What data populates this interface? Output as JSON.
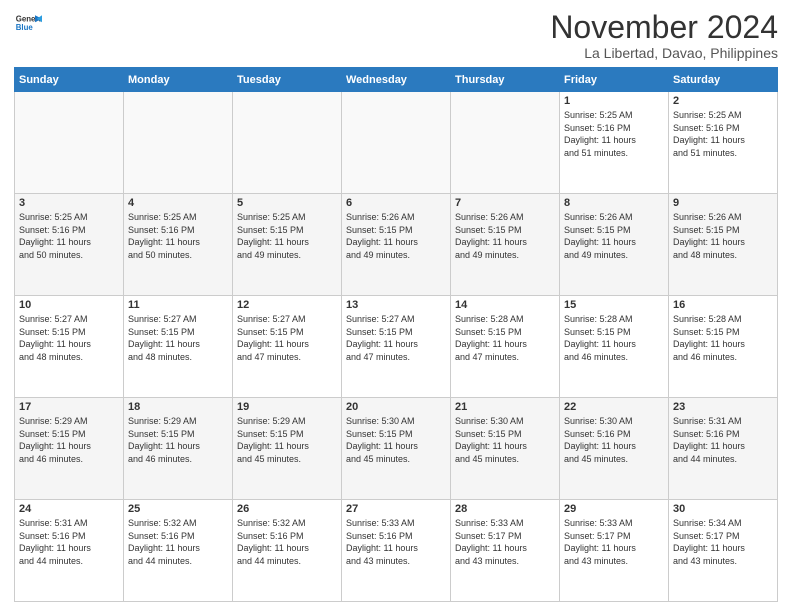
{
  "header": {
    "logo_line1": "General",
    "logo_line2": "Blue",
    "month": "November 2024",
    "location": "La Libertad, Davao, Philippines"
  },
  "weekdays": [
    "Sunday",
    "Monday",
    "Tuesday",
    "Wednesday",
    "Thursday",
    "Friday",
    "Saturday"
  ],
  "weeks": [
    [
      {
        "day": "",
        "info": ""
      },
      {
        "day": "",
        "info": ""
      },
      {
        "day": "",
        "info": ""
      },
      {
        "day": "",
        "info": ""
      },
      {
        "day": "",
        "info": ""
      },
      {
        "day": "1",
        "info": "Sunrise: 5:25 AM\nSunset: 5:16 PM\nDaylight: 11 hours\nand 51 minutes."
      },
      {
        "day": "2",
        "info": "Sunrise: 5:25 AM\nSunset: 5:16 PM\nDaylight: 11 hours\nand 51 minutes."
      }
    ],
    [
      {
        "day": "3",
        "info": "Sunrise: 5:25 AM\nSunset: 5:16 PM\nDaylight: 11 hours\nand 50 minutes."
      },
      {
        "day": "4",
        "info": "Sunrise: 5:25 AM\nSunset: 5:16 PM\nDaylight: 11 hours\nand 50 minutes."
      },
      {
        "day": "5",
        "info": "Sunrise: 5:25 AM\nSunset: 5:15 PM\nDaylight: 11 hours\nand 49 minutes."
      },
      {
        "day": "6",
        "info": "Sunrise: 5:26 AM\nSunset: 5:15 PM\nDaylight: 11 hours\nand 49 minutes."
      },
      {
        "day": "7",
        "info": "Sunrise: 5:26 AM\nSunset: 5:15 PM\nDaylight: 11 hours\nand 49 minutes."
      },
      {
        "day": "8",
        "info": "Sunrise: 5:26 AM\nSunset: 5:15 PM\nDaylight: 11 hours\nand 49 minutes."
      },
      {
        "day": "9",
        "info": "Sunrise: 5:26 AM\nSunset: 5:15 PM\nDaylight: 11 hours\nand 48 minutes."
      }
    ],
    [
      {
        "day": "10",
        "info": "Sunrise: 5:27 AM\nSunset: 5:15 PM\nDaylight: 11 hours\nand 48 minutes."
      },
      {
        "day": "11",
        "info": "Sunrise: 5:27 AM\nSunset: 5:15 PM\nDaylight: 11 hours\nand 48 minutes."
      },
      {
        "day": "12",
        "info": "Sunrise: 5:27 AM\nSunset: 5:15 PM\nDaylight: 11 hours\nand 47 minutes."
      },
      {
        "day": "13",
        "info": "Sunrise: 5:27 AM\nSunset: 5:15 PM\nDaylight: 11 hours\nand 47 minutes."
      },
      {
        "day": "14",
        "info": "Sunrise: 5:28 AM\nSunset: 5:15 PM\nDaylight: 11 hours\nand 47 minutes."
      },
      {
        "day": "15",
        "info": "Sunrise: 5:28 AM\nSunset: 5:15 PM\nDaylight: 11 hours\nand 46 minutes."
      },
      {
        "day": "16",
        "info": "Sunrise: 5:28 AM\nSunset: 5:15 PM\nDaylight: 11 hours\nand 46 minutes."
      }
    ],
    [
      {
        "day": "17",
        "info": "Sunrise: 5:29 AM\nSunset: 5:15 PM\nDaylight: 11 hours\nand 46 minutes."
      },
      {
        "day": "18",
        "info": "Sunrise: 5:29 AM\nSunset: 5:15 PM\nDaylight: 11 hours\nand 46 minutes."
      },
      {
        "day": "19",
        "info": "Sunrise: 5:29 AM\nSunset: 5:15 PM\nDaylight: 11 hours\nand 45 minutes."
      },
      {
        "day": "20",
        "info": "Sunrise: 5:30 AM\nSunset: 5:15 PM\nDaylight: 11 hours\nand 45 minutes."
      },
      {
        "day": "21",
        "info": "Sunrise: 5:30 AM\nSunset: 5:15 PM\nDaylight: 11 hours\nand 45 minutes."
      },
      {
        "day": "22",
        "info": "Sunrise: 5:30 AM\nSunset: 5:16 PM\nDaylight: 11 hours\nand 45 minutes."
      },
      {
        "day": "23",
        "info": "Sunrise: 5:31 AM\nSunset: 5:16 PM\nDaylight: 11 hours\nand 44 minutes."
      }
    ],
    [
      {
        "day": "24",
        "info": "Sunrise: 5:31 AM\nSunset: 5:16 PM\nDaylight: 11 hours\nand 44 minutes."
      },
      {
        "day": "25",
        "info": "Sunrise: 5:32 AM\nSunset: 5:16 PM\nDaylight: 11 hours\nand 44 minutes."
      },
      {
        "day": "26",
        "info": "Sunrise: 5:32 AM\nSunset: 5:16 PM\nDaylight: 11 hours\nand 44 minutes."
      },
      {
        "day": "27",
        "info": "Sunrise: 5:33 AM\nSunset: 5:16 PM\nDaylight: 11 hours\nand 43 minutes."
      },
      {
        "day": "28",
        "info": "Sunrise: 5:33 AM\nSunset: 5:17 PM\nDaylight: 11 hours\nand 43 minutes."
      },
      {
        "day": "29",
        "info": "Sunrise: 5:33 AM\nSunset: 5:17 PM\nDaylight: 11 hours\nand 43 minutes."
      },
      {
        "day": "30",
        "info": "Sunrise: 5:34 AM\nSunset: 5:17 PM\nDaylight: 11 hours\nand 43 minutes."
      }
    ]
  ]
}
